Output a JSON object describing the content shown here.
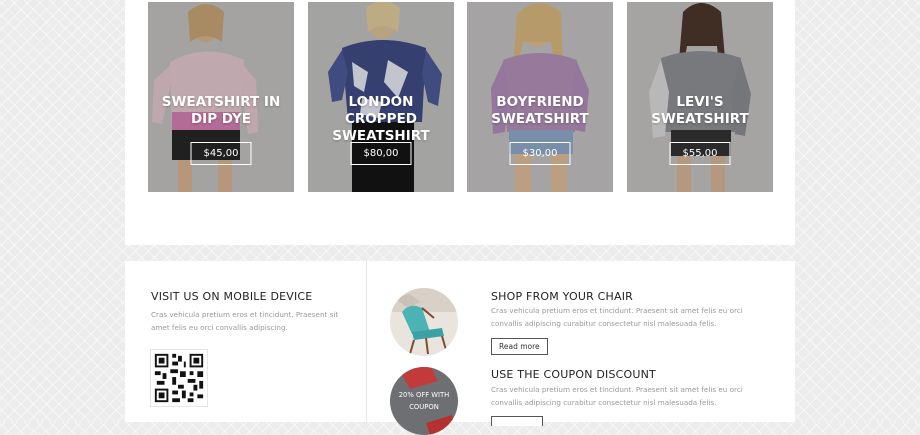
{
  "products": [
    {
      "name": "SWEATSHIRT IN DIP DYE",
      "price": "$45,00"
    },
    {
      "name": "LONDON CROPPED SWEATSHIRT",
      "price": "$80,00"
    },
    {
      "name": "BOYFRIEND SWEATSHIRT",
      "price": "$30,00"
    },
    {
      "name": "LEVI'S SWEATSHIRT",
      "price": "$55,00"
    }
  ],
  "mobile": {
    "title": "VISIT US ON MOBILE DEVICE",
    "text_line1": "Cras vehicula pretium eros et tincidunt. Praesent sit",
    "text_line2": "amet felis eu orci convallis adipiscing."
  },
  "features": [
    {
      "title": "SHOP FROM YOUR CHAIR",
      "text_line1": "Cras vehicula pretium eros et tincidunt. Praesent sit amet felis eu orci",
      "text_line2": "convallis adipiscing curabitur consectetur nisl malesuada felis.",
      "button": "Read more"
    },
    {
      "title": "USE THE COUPON DISCOUNT",
      "text_line1": "Cras vehicula pretium eros et tincidunt. Praesent sit amet felis eu orci",
      "text_line2": "convallis adipiscing curabitur consectetur nisl malesuada felis.",
      "badge": "20% OFF WITH COUPON"
    }
  ]
}
